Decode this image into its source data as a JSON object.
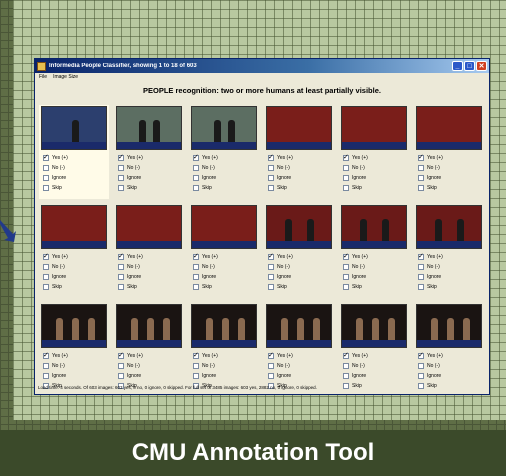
{
  "window": {
    "title": "Informedia People Classifier, showing 1 to 18 of 603",
    "menu": [
      "File",
      "Image Size"
    ],
    "heading": "PEOPLE recognition:  two or more humans at least partially visible.",
    "status": "Load time: 4 seconds.  Of 603 images: 603 yes, 0 no, 0 ignore, 0 skipped.  For full set of 3485 images: 603 yes, 2882 no, 0 ignore, 0 skipped.",
    "controls": {
      "minimize": "_",
      "maximize": "□",
      "close": "✕"
    }
  },
  "option_labels": [
    "Yes (+)",
    "No (-)",
    "Ignore",
    "Skip"
  ],
  "rows": [
    [
      {
        "scene": "podium",
        "bg": "#2c3f6e",
        "selected": "Yes (+)"
      },
      {
        "scene": "stage-suits",
        "bg": "#5c6e62",
        "selected": "Yes (+)"
      },
      {
        "scene": "stage-suits",
        "bg": "#5c6e62",
        "selected": "Yes (+)"
      },
      {
        "scene": "curtain",
        "bg": "#7a1e1a",
        "selected": "Yes (+)"
      },
      {
        "scene": "curtain",
        "bg": "#7a1e1a",
        "selected": "Yes (+)"
      },
      {
        "scene": "curtain",
        "bg": "#7a1e1a",
        "selected": "Yes (+)"
      }
    ],
    [
      {
        "scene": "curtain",
        "bg": "#7a1e1a",
        "selected": "Yes (+)"
      },
      {
        "scene": "curtain",
        "bg": "#7a1e1a",
        "selected": "Yes (+)"
      },
      {
        "scene": "curtain",
        "bg": "#7a1e1a",
        "selected": "Yes (+)"
      },
      {
        "scene": "curtain-people",
        "bg": "#6a1a18",
        "selected": "Yes (+)"
      },
      {
        "scene": "curtain-people",
        "bg": "#6a1a18",
        "selected": "Yes (+)"
      },
      {
        "scene": "curtain-people",
        "bg": "#6a1a18",
        "selected": "Yes (+)"
      }
    ],
    [
      {
        "scene": "dark-stage",
        "bg": "#1a1412",
        "selected": "Yes (+)"
      },
      {
        "scene": "dark-stage",
        "bg": "#1a1412",
        "selected": "Yes (+)"
      },
      {
        "scene": "dark-stage",
        "bg": "#1a1412",
        "selected": "Yes (+)"
      },
      {
        "scene": "dark-stage",
        "bg": "#1a1412",
        "selected": "Yes (+)"
      },
      {
        "scene": "dark-stage",
        "bg": "#1a1412",
        "selected": "Yes (+)"
      },
      {
        "scene": "dark-stage",
        "bg": "#1a1412",
        "selected": "Yes (+)"
      }
    ]
  ],
  "caption": "CMU Annotation Tool"
}
